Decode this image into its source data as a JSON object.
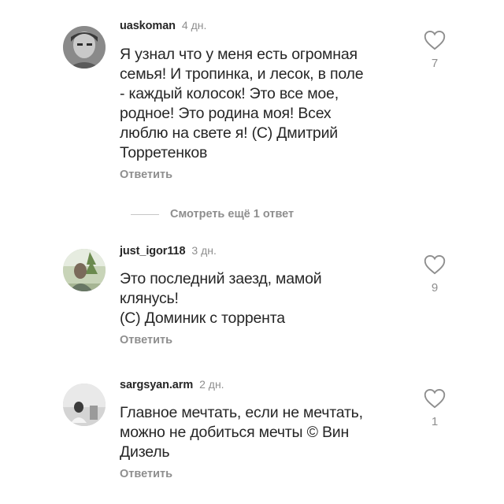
{
  "comments": [
    {
      "username": "uaskoman",
      "time": "4 дн.",
      "lines": [
        "Я узнал что у меня есть огромная",
        "семья! И тропинка, и лесок, в поле",
        "- каждый колосок! Это все мое,",
        "родное! Это родина моя! Всех",
        "люблю на свете я! (С) Дмитрий",
        "Торретенков"
      ],
      "reply_label": "Ответить",
      "likes": "7"
    },
    {
      "username": "just_igor118",
      "time": "3 дн.",
      "lines": [
        "Это последний заезд, мамой",
        "клянусь!",
        "(С) Доминик с торрента"
      ],
      "reply_label": "Ответить",
      "likes": "9"
    },
    {
      "username": "sargsyan.arm",
      "time": "2 дн.",
      "lines": [
        "Главное мечтать, если не мечтать,",
        "можно не добиться мечты © Вин",
        "Дизель"
      ],
      "reply_label": "Ответить",
      "likes": "1"
    }
  ],
  "more_replies_label": "Смотреть ещё 1 ответ",
  "icons": {
    "like": "heart-outline-icon"
  }
}
